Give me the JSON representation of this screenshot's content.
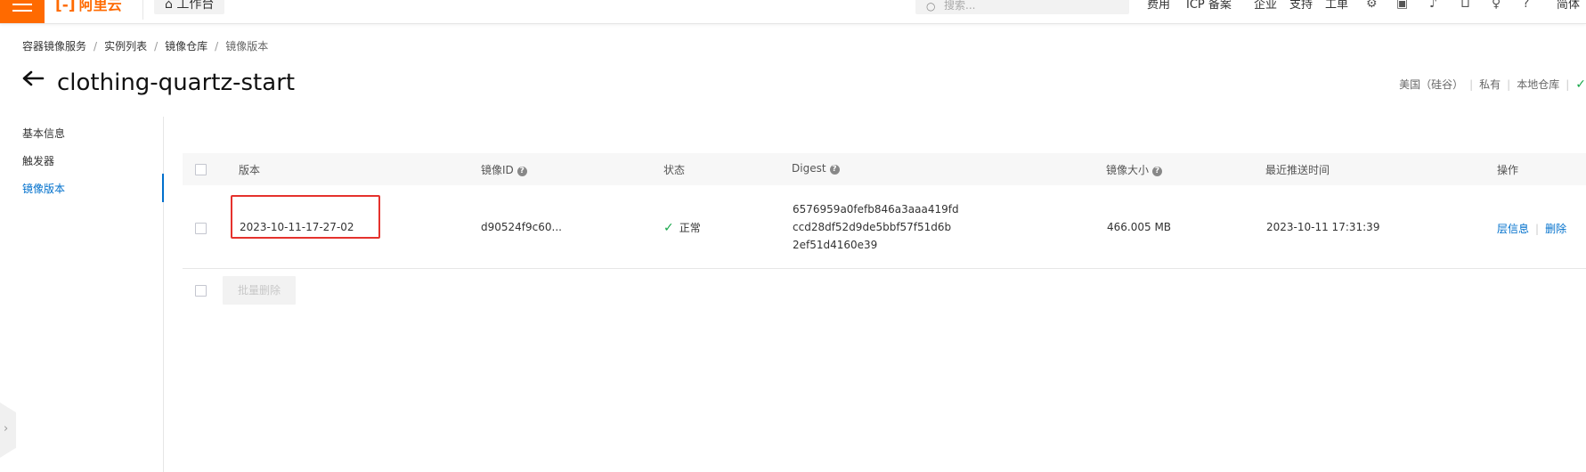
{
  "topbar": {
    "logo_text": "阿里云",
    "workbench": "工作台",
    "search_placeholder": "搜索...",
    "nav": [
      "费用",
      "ICP 备案",
      "企业",
      "支持",
      "工单"
    ],
    "user_text": "简体",
    "brand_color": "#ff6a00"
  },
  "breadcrumb": [
    "容器镜像服务",
    "实例列表",
    "镜像仓库",
    "镜像版本"
  ],
  "page": {
    "title": "clothing-quartz-start",
    "meta": {
      "region": "美国（硅谷）",
      "visibility": "私有",
      "source": "本地仓库"
    }
  },
  "leftnav": {
    "items": [
      {
        "label": "基本信息",
        "active": false
      },
      {
        "label": "触发器",
        "active": false
      },
      {
        "label": "镜像版本",
        "active": true
      }
    ]
  },
  "table": {
    "headers": {
      "version": "版本",
      "image_id": "镜像ID",
      "status": "状态",
      "digest": "Digest",
      "size": "镜像大小",
      "last_push": "最近推送时间",
      "actions": "操作"
    },
    "rows": [
      {
        "version": "2023-10-11-17-27-02",
        "image_id": "d90524f9c60...",
        "status": "正常",
        "digest": [
          "6576959a0fefb846a3aaa419fd",
          "ccd28df52d9de5bbf57f51d6b",
          "2ef51d4160e39"
        ],
        "size": "466.005 MB",
        "last_push": "2023-10-11 17:31:39",
        "action_info": "层信息",
        "action_delete": "删除"
      }
    ],
    "batch_delete": "批量删除"
  },
  "colors": {
    "accent": "#0070cc",
    "success": "#17a74a",
    "highlight_box": "#e5322d"
  }
}
